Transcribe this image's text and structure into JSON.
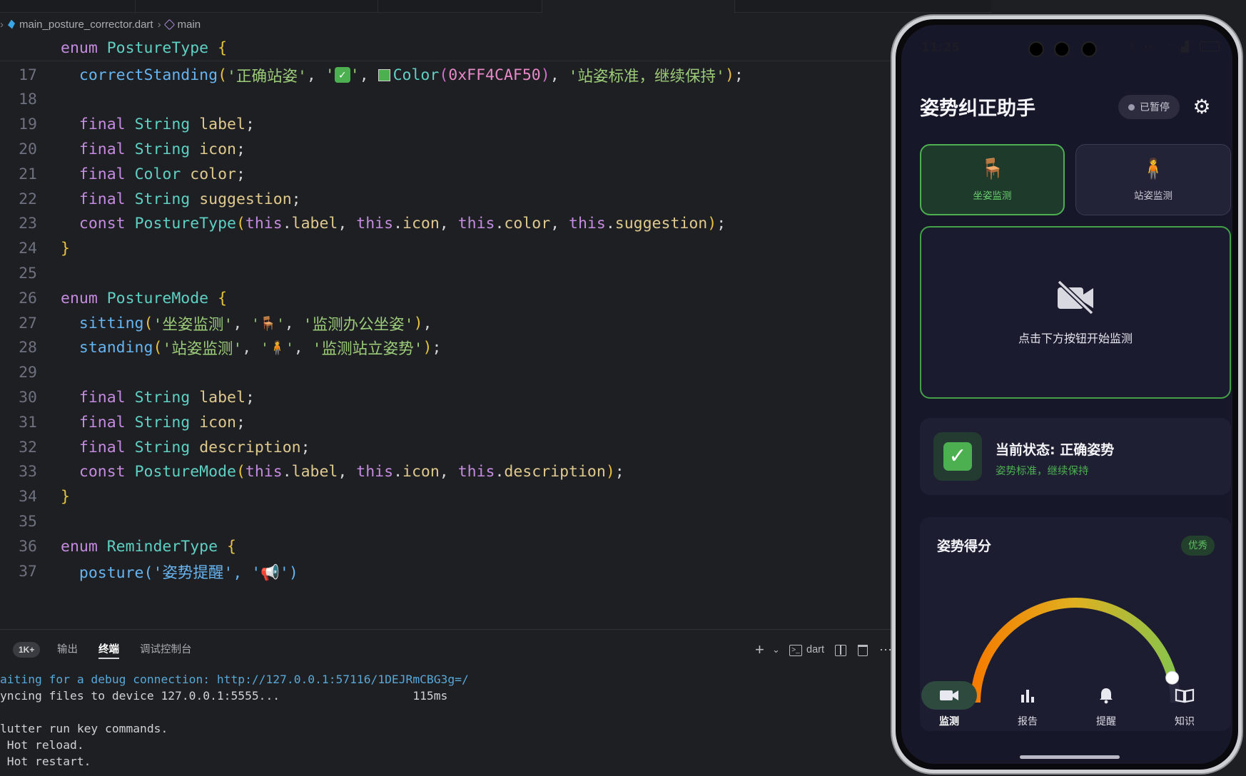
{
  "editor": {
    "breadcrumb": {
      "file": "main_posture_corrector.dart",
      "symbol": "main"
    },
    "sticky": {
      "kw": "enum",
      "name": "PostureType",
      "brace": "{"
    },
    "lines": [
      {
        "n": "17"
      },
      {
        "n": "18"
      },
      {
        "n": "19",
        "kw": "final",
        "type": "String",
        "name": "label"
      },
      {
        "n": "20",
        "kw": "final",
        "type": "String",
        "name": "icon"
      },
      {
        "n": "21",
        "kw": "final",
        "type": "Color",
        "name": "color"
      },
      {
        "n": "22",
        "kw": "final",
        "type": "String",
        "name": "suggestion"
      },
      {
        "n": "23"
      },
      {
        "n": "24",
        "text": "}"
      },
      {
        "n": "25"
      },
      {
        "n": "26",
        "kw": "enum",
        "name": "PostureMode",
        "brace": "{"
      },
      {
        "n": "27"
      },
      {
        "n": "28"
      },
      {
        "n": "29"
      },
      {
        "n": "30",
        "kw": "final",
        "type": "String",
        "name": "label"
      },
      {
        "n": "31",
        "kw": "final",
        "type": "String",
        "name": "icon"
      },
      {
        "n": "32",
        "kw": "final",
        "type": "String",
        "name": "description"
      },
      {
        "n": "33"
      },
      {
        "n": "34",
        "text": "}"
      },
      {
        "n": "35"
      },
      {
        "n": "36",
        "kw": "enum",
        "name": "ReminderType",
        "brace": "{"
      },
      {
        "n": "37",
        "partial": "posture('姿势提醒', '📢')"
      }
    ],
    "line17": {
      "member": "correctStanding",
      "label": "'正确站姿'",
      "icon": "✓",
      "colorCall": "Color",
      "colorValue": "0xFF4CAF50",
      "suggestion": "'站姿标准，继续保持'"
    },
    "line23": {
      "kw": "const",
      "ctor": "PostureType",
      "this": "this",
      "p1": "label",
      "p2": "icon",
      "p3": "color",
      "p4": "suggestion"
    },
    "line27": {
      "member": "sitting",
      "label": "'坐姿监测'",
      "icon": "'🪑'",
      "desc": "'监测办公坐姿'"
    },
    "line28": {
      "member": "standing",
      "label": "'站姿监测'",
      "icon": "'🧍'",
      "desc": "'监测站立姿势'"
    },
    "line33": {
      "kw": "const",
      "ctor": "PostureMode",
      "this": "this",
      "p1": "label",
      "p2": "icon",
      "p3": "description"
    }
  },
  "panel": {
    "tabs": {
      "problems_badge": "1K+",
      "output": "输出",
      "terminal": "终端",
      "debug_console": "调试控制台"
    },
    "actions": {
      "add": "+",
      "chevron": "⌄",
      "shell": "dart"
    },
    "terminal_lines": [
      {
        "text": "aiting for a debug connection: http://127.0.0.1:57116/1DEJRmCBG3g=/",
        "link": true
      },
      {
        "text": "yncing files to device 127.0.0.1:5555...                   115ms",
        "link": false
      },
      {
        "text": "",
        "link": false
      },
      {
        "text": "lutter run key commands.",
        "link": false
      },
      {
        "text": " Hot reload.",
        "link": false
      },
      {
        "text": " Hot restart.",
        "link": false
      }
    ]
  },
  "phone": {
    "status_time": "11:25",
    "app_title": "姿势纠正助手",
    "status_pill": "已暂停",
    "modes": [
      {
        "emoji": "🪑",
        "label": "坐姿监测",
        "active": true
      },
      {
        "emoji": "🧍",
        "label": "站姿监测",
        "active": false
      }
    ],
    "camera_hint": "点击下方按钮开始监测",
    "current_status": {
      "title": "当前状态: 正确姿势",
      "suggestion": "姿势标准，继续保持",
      "check": "✓"
    },
    "score": {
      "title": "姿势得分",
      "badge": "优秀",
      "value_fraction": 1.0
    },
    "nav": [
      {
        "label": "监测",
        "icon": "videocam-icon",
        "active": true
      },
      {
        "label": "报告",
        "icon": "bar-chart-icon",
        "active": false
      },
      {
        "label": "提醒",
        "icon": "bell-icon",
        "active": false
      },
      {
        "label": "知识",
        "icon": "book-icon",
        "active": false
      }
    ],
    "colors": {
      "accent": "#4caf50",
      "background": "#17172a",
      "gauge_start": "#f57c00",
      "gauge_mid": "#e0b020",
      "gauge_end": "#8bc34a"
    }
  }
}
